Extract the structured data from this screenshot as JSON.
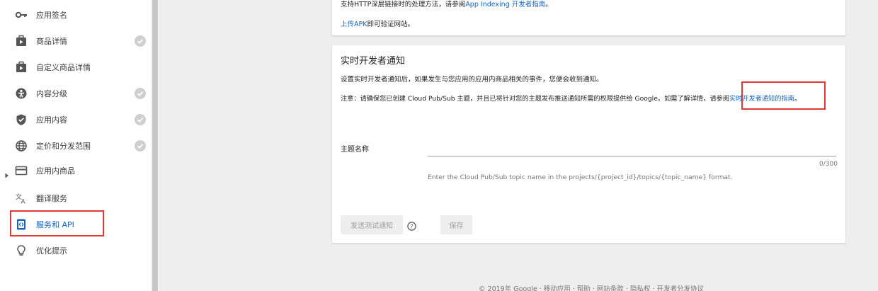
{
  "sidebar": {
    "items": [
      {
        "label": "应用签名",
        "icon": "key-icon",
        "checked": false
      },
      {
        "label": "商品详情",
        "icon": "store-icon",
        "checked": true
      },
      {
        "label": "自定义商品详情",
        "icon": "store-icon",
        "checked": false
      },
      {
        "label": "内容分级",
        "icon": "content-rating-icon",
        "checked": true
      },
      {
        "label": "应用内容",
        "icon": "shield-icon",
        "checked": true
      },
      {
        "label": "定价和分发范围",
        "icon": "globe-icon",
        "checked": true
      },
      {
        "label": "应用内商品",
        "icon": "card-icon",
        "checked": false
      },
      {
        "label": "翻译服务",
        "icon": "translate-icon",
        "checked": false
      },
      {
        "label": "服务和 API",
        "icon": "api-icon",
        "checked": false,
        "active": true
      },
      {
        "label": "优化提示",
        "icon": "lightbulb-icon",
        "checked": false
      }
    ]
  },
  "top_card": {
    "line1_text": "支持HTTP深层链接时的处理方法，请参阅",
    "line1_link": "App Indexing 开发者指南",
    "line1_end": "。",
    "line2_link": "上传APK",
    "line2_text": "即可验证网站。"
  },
  "rtdn": {
    "title": "实时开发者通知",
    "desc": "设置实时开发者通知后，如果发生与您应用的应用内商品相关的事件，您便会收到通知。",
    "note_text": "注意：请确保您已创建 Cloud Pub/Sub 主题，并且已将针对您的主题发布推送通知所需的权限提供给 Google。如需了解详情，请参阅",
    "note_link": "实时开发者通知的指南",
    "note_end": "。",
    "field_label": "主题名称",
    "field_value": "",
    "char_count": "0/300",
    "hint": "Enter the Cloud Pub/Sub topic name in the projects/{project_id}/topics/{topic_name} format.",
    "send_test_label": "发送测试通知",
    "save_label": "保存"
  },
  "footer": "© 2019年 Google · 移动应用 · 帮助 · 网站条款 · 隐私权 · 开发者分发协议",
  "colors": {
    "accent": "#1565c0",
    "highlight": "#e53935"
  }
}
